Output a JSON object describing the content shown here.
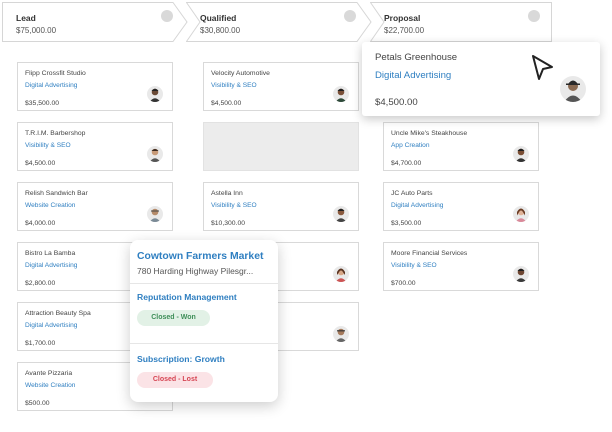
{
  "pipeline": {
    "stages": [
      {
        "name": "Lead",
        "amount": "$75,000.00"
      },
      {
        "name": "Qualified",
        "amount": "$30,800.00"
      },
      {
        "name": "Proposal",
        "amount": "$22,700.00"
      }
    ]
  },
  "cards": {
    "lead": [
      {
        "name": "Flipp Crossfit Studio",
        "service": "Digital Advertising",
        "amount": "$35,500.00"
      },
      {
        "name": "T.R.I.M. Barbershop",
        "service": "Visibility & SEO",
        "amount": "$4,500.00"
      },
      {
        "name": "Relish Sandwich Bar",
        "service": "Website Creation",
        "amount": "$4,000.00"
      },
      {
        "name": "Bistro La Bamba",
        "service": "Digital Advertising",
        "amount": "$2,800.00"
      },
      {
        "name": "Attraction Beauty Spa",
        "service": "Digital Advertising",
        "amount": "$1,700.00"
      },
      {
        "name": "Avante Pizzaria",
        "service": "Website Creation",
        "amount": "$500.00"
      }
    ],
    "qualified": [
      {
        "name": "Velocity Automotive",
        "service": "Visibility & SEO",
        "amount": "$4,500.00"
      },
      {
        "name": "Astella Inn",
        "service": "Visibility & SEO",
        "amount": "$10,300.00"
      }
    ],
    "proposal": [
      {
        "name": "Uncle Mike's Steakhouse",
        "service": "App Creation",
        "amount": "$4,700.00"
      },
      {
        "name": "JC Auto Parts",
        "service": "Digital Advertising",
        "amount": "$3,500.00"
      },
      {
        "name": "Moore Financial Services",
        "service": "Visibility & SEO",
        "amount": "$700.00"
      }
    ]
  },
  "dragged_card": {
    "name": "Petals Greenhouse",
    "service": "Digital Advertising",
    "amount": "$4,500.00"
  },
  "contact_popup": {
    "title": "Cowtown Farmers Market",
    "address": "780 Harding Highway Pilesgr...",
    "opportunities": [
      {
        "title": "Reputation Management",
        "status": "Closed - Won"
      },
      {
        "title": "Subscription: Growth",
        "status": "Closed - Lost"
      }
    ]
  },
  "colors": {
    "accent": "#2f7fc1",
    "won": "#3e8e58",
    "lost": "#d64553"
  }
}
